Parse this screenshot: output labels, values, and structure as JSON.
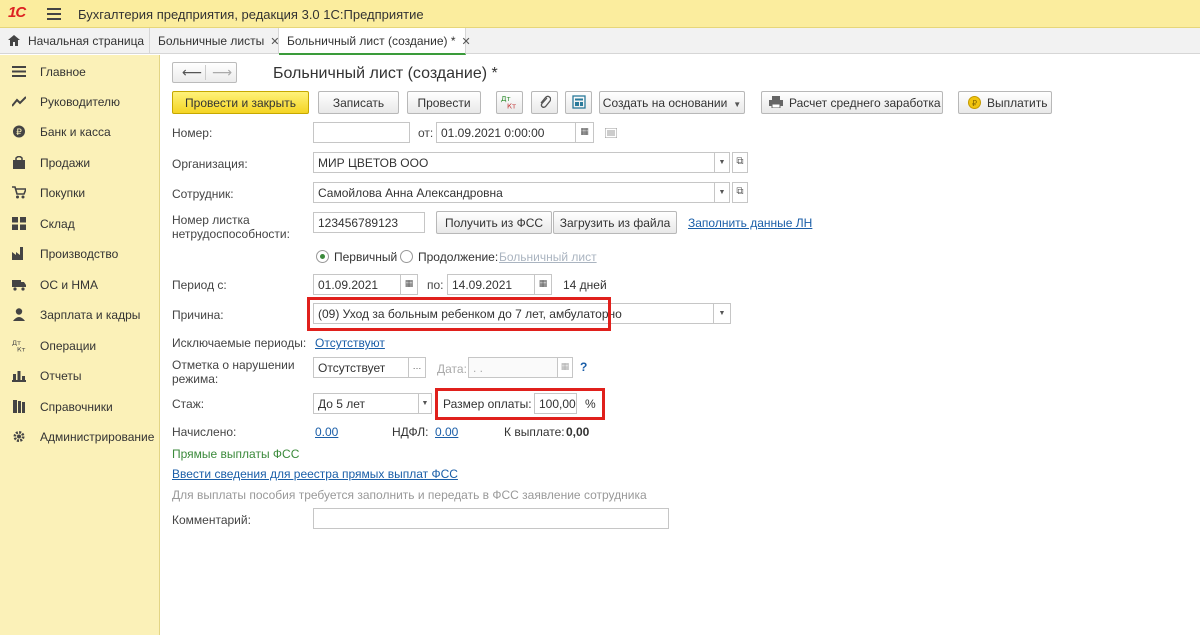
{
  "window": {
    "logo": "1С",
    "title": "Бухгалтерия предприятия, редакция 3.0 1С:Предприятие"
  },
  "tabs": [
    {
      "label": "Начальная страница"
    },
    {
      "label": "Больничные листы",
      "close": "✕"
    },
    {
      "label": "Больничный лист (создание) *",
      "close": "✕"
    }
  ],
  "sidebar": {
    "items": [
      {
        "label": "Главное",
        "icon": "menu-icon"
      },
      {
        "label": "Руководителю",
        "icon": "trend-icon"
      },
      {
        "label": "Банк и касса",
        "icon": "coin-icon"
      },
      {
        "label": "Продажи",
        "icon": "bag-icon"
      },
      {
        "label": "Покупки",
        "icon": "cart-icon"
      },
      {
        "label": "Склад",
        "icon": "grid-icon"
      },
      {
        "label": "Производство",
        "icon": "factory-icon"
      },
      {
        "label": "ОС и НМА",
        "icon": "truck-icon"
      },
      {
        "label": "Зарплата и кадры",
        "icon": "person-icon"
      },
      {
        "label": "Операции",
        "icon": "dt-kt-icon"
      },
      {
        "label": "Отчеты",
        "icon": "bar-chart-icon"
      },
      {
        "label": "Справочники",
        "icon": "books-icon"
      },
      {
        "label": "Администрирование",
        "icon": "gear-icon"
      }
    ]
  },
  "doc": {
    "title": "Больничный лист (создание) *"
  },
  "toolbar": {
    "post_close": "Провести и закрыть",
    "save": "Записать",
    "post": "Провести",
    "dt_kt": "Дт Кт",
    "create_based": "Создать на основании",
    "avg_earnings": "Расчет среднего заработка",
    "pay": "Выплатить"
  },
  "form": {
    "number_label": "Номер:",
    "number_value": "",
    "from_label": "от:",
    "date_value": "01.09.2021  0:00:00",
    "org_label": "Организация:",
    "org_value": "МИР ЦВЕТОВ ООО",
    "employee_label": "Сотрудник:",
    "employee_value": "Самойлова Анна Александровна",
    "sheet_number_label": "Номер листка нетрудоспособности:",
    "sheet_number_value": "123456789123",
    "get_fss_button": "Получить из ФСС",
    "load_file_button": "Загрузить из файла",
    "fill_ln_link": "Заполнить данные ЛН",
    "primary_label": "Первичный",
    "continuation_label": "Продолжение:",
    "sick_list_link": "Больничный лист",
    "period_label": "Период с:",
    "period_from": "01.09.2021",
    "period_to_label": "по:",
    "period_to": "14.09.2021",
    "days_text": "14 дней",
    "reason_label": "Причина:",
    "reason_value": "(09) Уход за больным ребенком до 7 лет, амбулаторно",
    "excluded_label": "Исключаемые периоды:",
    "excluded_link": "Отсутствуют",
    "violation_label": "Отметка о нарушении режима:",
    "violation_value": "Отсутствует",
    "violation_date_label": "Дата:",
    "violation_date_value": " .  .",
    "help_mark": "?",
    "experience_label": "Стаж:",
    "experience_value": "До 5 лет",
    "pay_size_label": "Размер оплаты:",
    "pay_size_value": "100,00",
    "pay_size_unit": "%",
    "accrued_label": "Начислено:",
    "accrued_value": "0.00",
    "ndfl_label": "НДФЛ:",
    "ndfl_value": "0.00",
    "to_pay_label": "К выплате:",
    "to_pay_value": "0,00",
    "direct_payments": "Прямые выплаты ФСС",
    "direct_registry_link": "Ввести сведения для реестра прямых выплат ФСС",
    "note": "Для выплаты пособия требуется заполнить и передать в ФСС заявление сотрудника",
    "comment_label": "Комментарий:",
    "comment_value": ""
  },
  "colors": {
    "accent_green": "#3b8a3b",
    "highlight_red": "#e0201c",
    "sidebar_bg": "#fbf1b8",
    "primary_button": "#f4d423"
  }
}
